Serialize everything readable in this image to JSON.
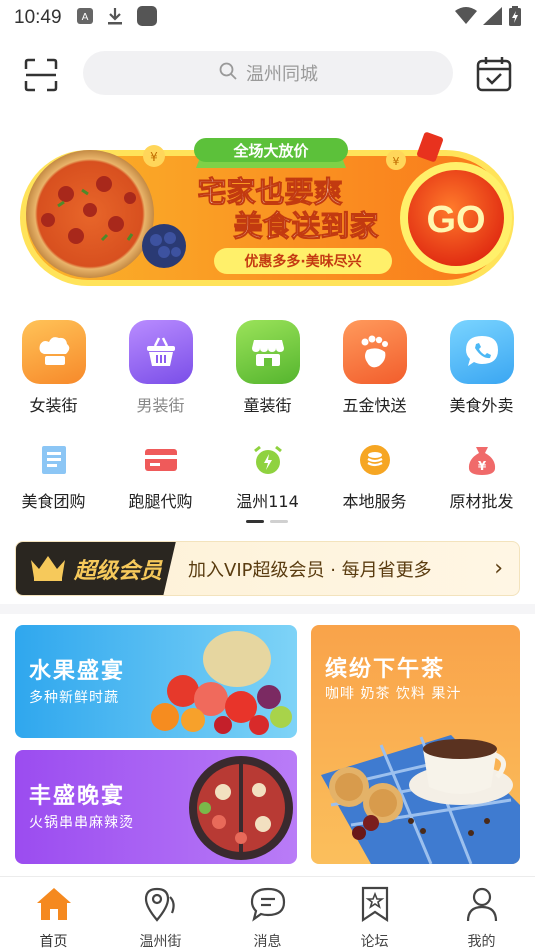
{
  "status_bar": {
    "time": "10:49",
    "icons": [
      "a-notification-icon",
      "download-icon",
      "app-square-icon",
      "wifi-icon",
      "signal-icon",
      "battery-icon"
    ]
  },
  "header": {
    "search_placeholder": "温州同城",
    "left_icon": "scan-icon",
    "right_icon": "calendar-check-icon"
  },
  "banner": {
    "ribbon": "全场大放价",
    "headline_1": "宅家也要爽",
    "headline_2": "美食送到家",
    "tagline": "优惠多多·美味尽兴",
    "go_label": "GO"
  },
  "categories_row1": [
    {
      "label": "女装街",
      "icon": "chef-hat-icon",
      "color": "#f9a23a"
    },
    {
      "label": "男装街",
      "icon": "basket-icon",
      "color": "#9b6cf2"
    },
    {
      "label": "童装街",
      "icon": "storefront-icon",
      "color": "#78cf45"
    },
    {
      "label": "五金快送",
      "icon": "footprint-icon",
      "color": "#f7763e"
    },
    {
      "label": "美食外卖",
      "icon": "phone-bubble-icon",
      "color": "#4bb8f5"
    }
  ],
  "categories_row2": [
    {
      "label": "美食团购",
      "icon": "document-icon",
      "color": "#5aa8ee"
    },
    {
      "label": "跑腿代购",
      "icon": "card-icon",
      "color": "#ef5a5a"
    },
    {
      "label": "温州114",
      "icon": "alarm-clock-icon",
      "color": "#8fd23f"
    },
    {
      "label": "本地服务",
      "icon": "coin-stack-icon",
      "color": "#f6a623"
    },
    {
      "label": "原材批发",
      "icon": "money-bag-icon",
      "color": "#f06a6a"
    }
  ],
  "vip": {
    "badge": "超级会员",
    "text": "加入VIP超级会员 · 每月省更多",
    "arrow": "›"
  },
  "promo_cards": {
    "fruit": {
      "title": "水果盛宴",
      "subtitle": "多种新鲜时蔬"
    },
    "tea": {
      "title": "缤纷下午茶",
      "subtitle": "咖啡 奶茶 饮料 果汁"
    },
    "dinner": {
      "title": "丰盛晚宴",
      "subtitle": "火锅串串麻辣烫"
    }
  },
  "tabbar": [
    {
      "label": "首页",
      "icon": "home-icon",
      "active": true
    },
    {
      "label": "温州街",
      "icon": "map-pin-icon",
      "active": false
    },
    {
      "label": "消息",
      "icon": "chat-bubble-icon",
      "active": false
    },
    {
      "label": "论坛",
      "icon": "bookmark-star-icon",
      "active": false
    },
    {
      "label": "我的",
      "icon": "person-icon",
      "active": false
    }
  ],
  "colors": {
    "accent_orange": "#f5891f",
    "vip_gold": "#f6c95b"
  }
}
